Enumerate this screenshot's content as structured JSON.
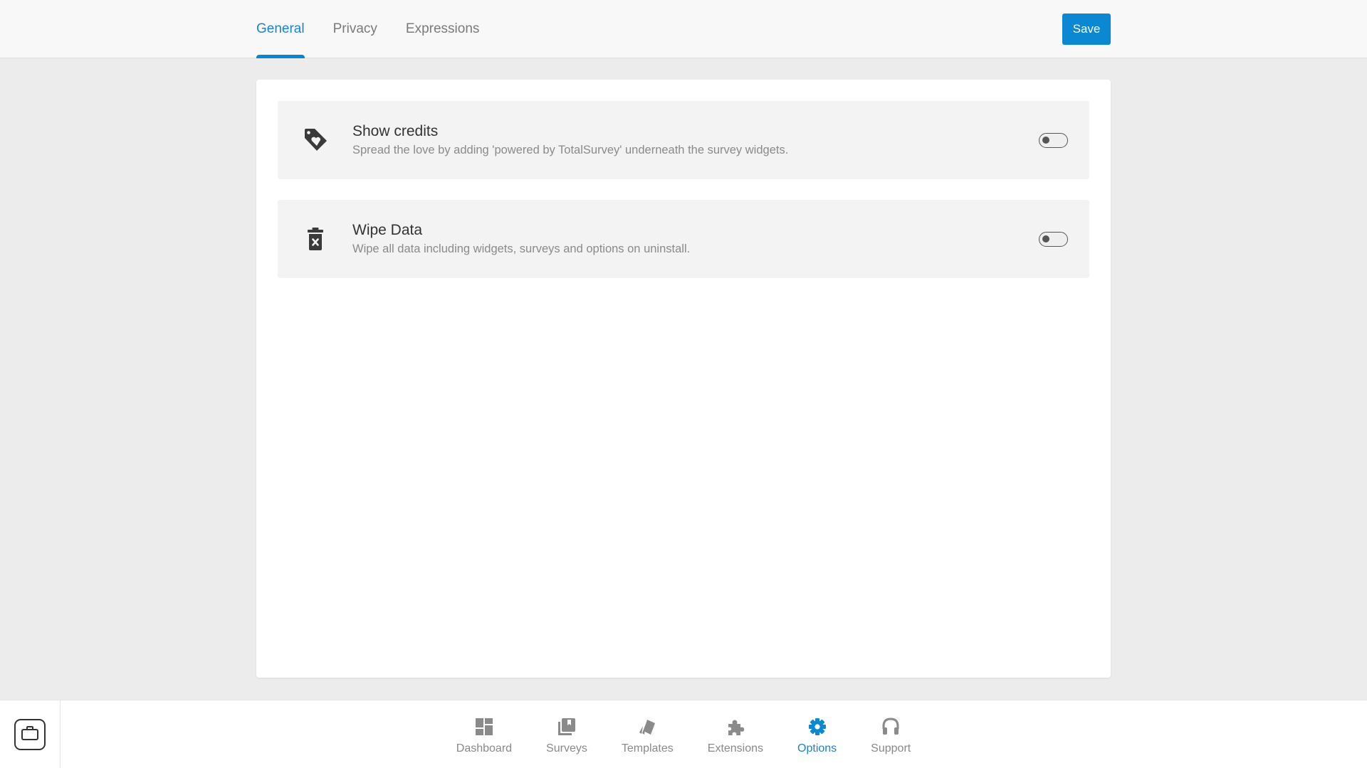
{
  "header": {
    "tabs": [
      {
        "label": "General",
        "active": true
      },
      {
        "label": "Privacy",
        "active": false
      },
      {
        "label": "Expressions",
        "active": false
      }
    ],
    "save_label": "Save"
  },
  "options": [
    {
      "icon": "tag-heart-icon",
      "title": "Show credits",
      "description": "Spread the love by adding 'powered by TotalSurvey' underneath the survey widgets.",
      "enabled": false
    },
    {
      "icon": "trash-x-icon",
      "title": "Wipe Data",
      "description": "Wipe all data including widgets, surveys and options on uninstall.",
      "enabled": false
    }
  ],
  "bottom_nav": {
    "corner_icon": "briefcase-icon",
    "items": [
      {
        "label": "Dashboard",
        "icon": "dashboard-icon",
        "active": false
      },
      {
        "label": "Surveys",
        "icon": "surveys-icon",
        "active": false
      },
      {
        "label": "Templates",
        "icon": "templates-icon",
        "active": false
      },
      {
        "label": "Extensions",
        "icon": "puzzle-icon",
        "active": false
      },
      {
        "label": "Options",
        "icon": "gear-icon",
        "active": true
      },
      {
        "label": "Support",
        "icon": "headphones-icon",
        "active": false
      }
    ]
  },
  "colors": {
    "accent": "#0b88d1",
    "icon_gray": "#8a8a8a",
    "icon_dark": "#3a3a3a"
  }
}
